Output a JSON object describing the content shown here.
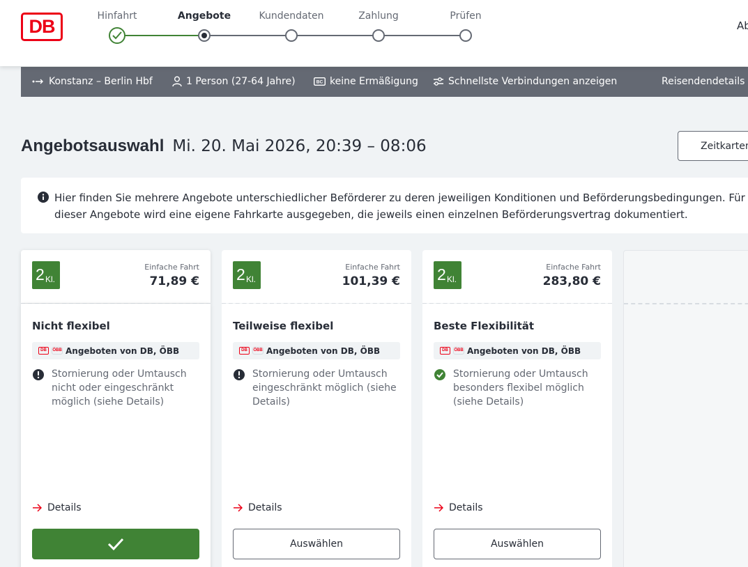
{
  "header": {
    "logo_text": "DB",
    "steps": [
      {
        "label": "Hinfahrt",
        "state": "done"
      },
      {
        "label": "Angebote",
        "state": "current"
      },
      {
        "label": "Kundendaten",
        "state": "pending"
      },
      {
        "label": "Zahlung",
        "state": "pending"
      },
      {
        "label": "Prüfen",
        "state": "pending"
      }
    ],
    "right_text": "Ab"
  },
  "summary": {
    "route": "Konstanz – Berlin Hbf",
    "persons": "1 Person (27-64 Jahre)",
    "discount": "keine Ermäßigung",
    "fastest": "Schnellste Verbindungen anzeigen",
    "traveler_details": "Reisendendetails ar"
  },
  "title": {
    "main": "Angebotsauswahl",
    "date": "Mi. 20. Mai 2026, 20:39 – 08:06",
    "zeitkarten_label": "Zeitkarten"
  },
  "info": {
    "line1": "Hier finden Sie mehrere Angebote unterschiedlicher Beförderer zu deren jeweiligen Konditionen und Beförderungsbedingungen. Für j",
    "line2": "dieser Angebote wird eine eigene Fahrkarte ausgegeben, die jeweils einen einzelnen Beförderungsvertrag dokumentiert."
  },
  "offers": [
    {
      "class_num": "2",
      "class_txt": "Kl.",
      "fare_type": "Einfache Fahrt",
      "price": "71,89 €",
      "title": "Nicht flexibel",
      "provider": "Angeboten von DB, ÖBB",
      "cond_line1": "Stornierung oder Umtausch",
      "cond_line2": "nicht oder eingeschränkt",
      "cond_line3": "möglich (siehe Details)",
      "cond_status": "warning",
      "details": "Details",
      "button": "",
      "selected": true
    },
    {
      "class_num": "2",
      "class_txt": "Kl.",
      "fare_type": "Einfache Fahrt",
      "price": "101,39 €",
      "title": "Teilweise flexibel",
      "provider": "Angeboten von DB, ÖBB",
      "cond_line1": "Stornierung oder Umtausch",
      "cond_line2": "eingeschränkt möglich (siehe",
      "cond_line3": "Details)",
      "cond_status": "warning",
      "details": "Details",
      "button": "Auswählen",
      "selected": false
    },
    {
      "class_num": "2",
      "class_txt": "Kl.",
      "fare_type": "Einfache Fahrt",
      "price": "283,80 €",
      "title": "Beste Flexibilität",
      "provider": "Angeboten von DB, ÖBB",
      "cond_line1": "Stornierung oder Umtausch",
      "cond_line2": "besonders flexibel möglich",
      "cond_line3": "(siehe Details)",
      "cond_status": "ok",
      "details": "Details",
      "button": "Auswählen",
      "selected": false
    }
  ],
  "colors": {
    "brand_red": "#ec0016",
    "green": "#408335",
    "summary_bg": "#646973",
    "page_bg": "#f0f3f5"
  },
  "icons": {
    "route": "arrow-right-icon",
    "person": "person-icon",
    "bahncard": "bahncard-icon",
    "filter": "sliders-icon",
    "info": "info-icon",
    "warning": "exclamation-circle-icon",
    "ok": "check-circle-icon",
    "details": "arrow-right-red-icon",
    "selected": "checkmark-icon"
  }
}
